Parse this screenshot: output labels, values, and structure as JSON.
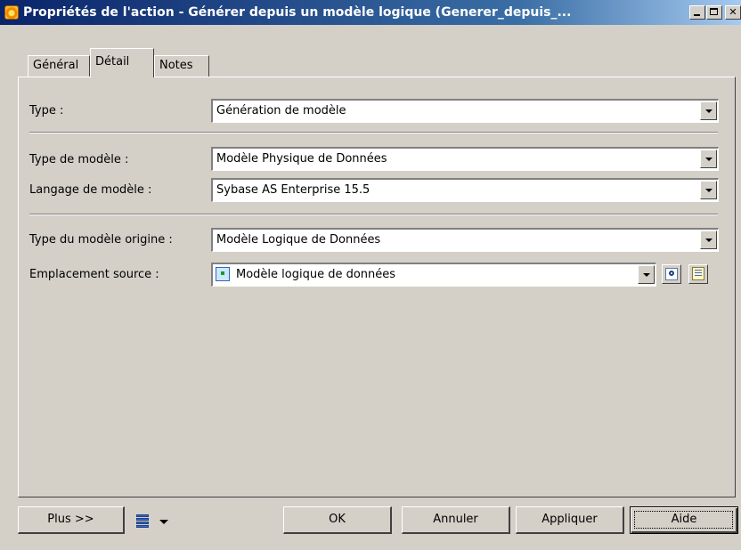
{
  "window": {
    "title": "Propriétés de l'action - Générer depuis un modèle logique (Generer_depuis_..."
  },
  "tabs": [
    {
      "label": "Général"
    },
    {
      "label": "Détail"
    },
    {
      "label": "Notes"
    }
  ],
  "form": {
    "type": {
      "label": "Type :",
      "value": "Génération de modèle"
    },
    "model_type": {
      "label": "Type de modèle :",
      "value": "Modèle Physique de Données"
    },
    "model_language": {
      "label": "Langage de modèle :",
      "value": "Sybase AS Enterprise 15.5"
    },
    "origin_model_type": {
      "label": "Type du modèle origine :",
      "value": "Modèle Logique de Données"
    },
    "source_location": {
      "label": "Emplacement source :",
      "value": "Modèle logique de données"
    }
  },
  "buttons": {
    "more": "Plus >>",
    "ok": "OK",
    "cancel": "Annuler",
    "apply": "Appliquer",
    "help": "Aide"
  },
  "icons": {
    "window": "action-icon",
    "source_model": "logical-model-icon",
    "find": "find-object-icon",
    "properties": "properties-icon",
    "layout": "layout-menu-icon"
  }
}
